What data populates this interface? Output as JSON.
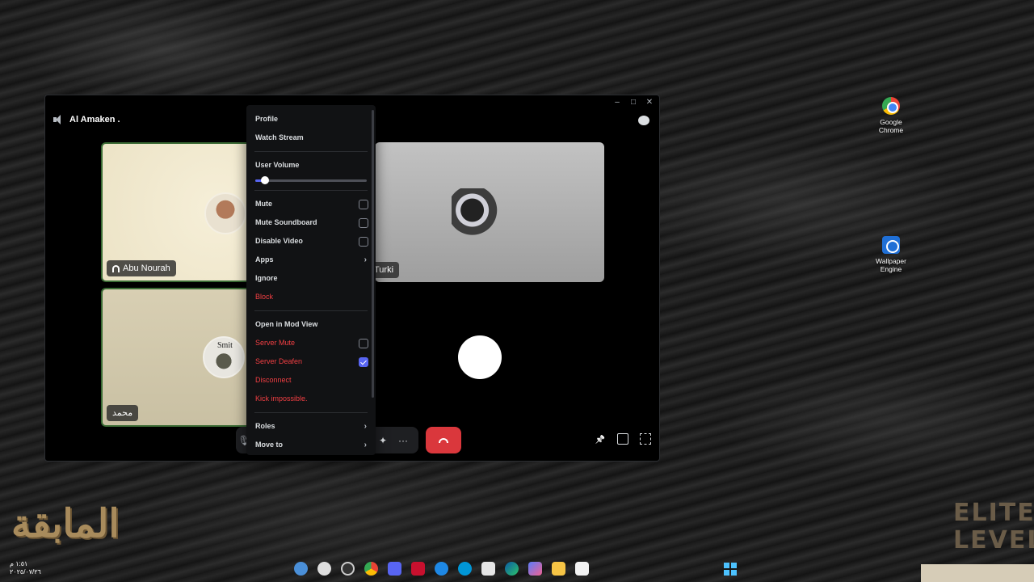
{
  "desktop": {
    "icons": [
      {
        "label_1": "Google",
        "label_2": "Chrome"
      },
      {
        "label_1": "Wallpaper",
        "label_2": "Engine"
      }
    ]
  },
  "window": {
    "controls": {
      "minimize": "–",
      "maximize": "□",
      "close": "✕"
    },
    "channel_name": "Al Amaken ."
  },
  "tiles": [
    {
      "name": "Abu Nourah"
    },
    {
      "name": "Turki"
    },
    {
      "name": "محمد"
    }
  ],
  "tile_3_avatar_text": "Smit",
  "controls": {
    "mic": "🎙",
    "activity": "✦",
    "more": "···"
  },
  "menu": {
    "profile": "Profile",
    "watch_stream": "Watch Stream",
    "user_volume": "User Volume",
    "user_volume_fraction": 0.09,
    "mute": "Mute",
    "mute_soundboard": "Mute Soundboard",
    "disable_video": "Disable Video",
    "apps": "Apps",
    "ignore": "Ignore",
    "block": "Block",
    "open_mod_view": "Open in Mod View",
    "server_mute": "Server Mute",
    "server_deafen": "Server Deafen",
    "server_deafen_checked": true,
    "disconnect": "Disconnect",
    "kick": "Kick impossible.",
    "roles": "Roles",
    "move_to": "Move to"
  },
  "logos": {
    "left_text": "المابقة",
    "right_text_1": "ELITE",
    "right_text_2": "LEVEL"
  },
  "taskbar": {
    "time": "١:٥١ م",
    "date": "٢٠٢٥/٠٧/٢٦"
  },
  "colors": {
    "accent": "#5865f2",
    "danger": "#f23f43",
    "hangup": "#da373c"
  }
}
